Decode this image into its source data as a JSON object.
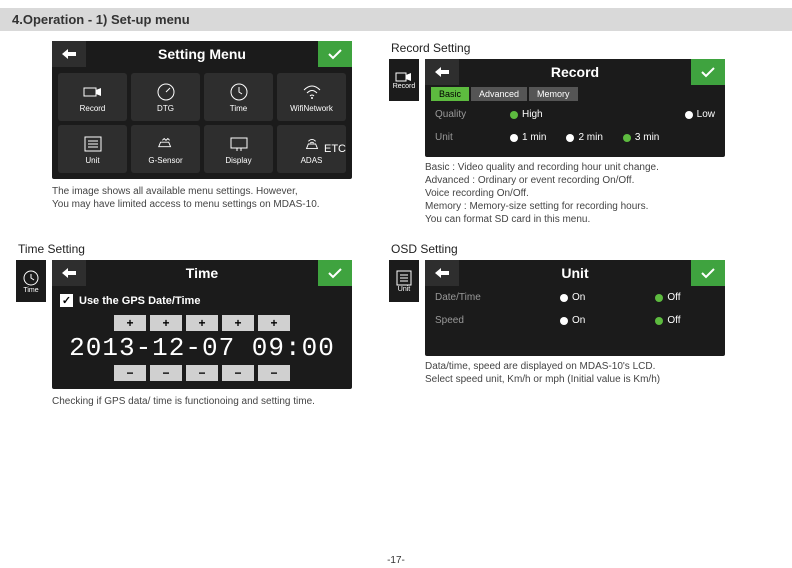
{
  "section_title": "4.Operation - 1) Set-up menu",
  "page_number": "-17-",
  "setting_menu": {
    "title": "Setting Menu",
    "items": [
      {
        "label": "Record"
      },
      {
        "label": "DTG"
      },
      {
        "label": "Time"
      },
      {
        "label": "WifiNetwork"
      },
      {
        "label": "Unit"
      },
      {
        "label": "G-Sensor"
      },
      {
        "label": "Display"
      },
      {
        "label": "ADAS"
      },
      {
        "label": "ETC"
      }
    ],
    "caption1": "The image shows all available menu settings. However,",
    "caption2": "You may have limited access to menu settings on MDAS-10."
  },
  "record": {
    "panel_title": "Record Setting",
    "title": "Record",
    "side_label": "Record",
    "tabs": [
      {
        "label": "Basic",
        "active": true
      },
      {
        "label": "Advanced"
      },
      {
        "label": "Memory"
      }
    ],
    "quality_label": "Quality",
    "quality_opts": [
      {
        "label": "High",
        "sel": true
      },
      {
        "label": "Low",
        "sel": false
      }
    ],
    "unit_label": "Unit",
    "unit_opts": [
      {
        "label": "1 min"
      },
      {
        "label": "2 min"
      },
      {
        "label": "3 min",
        "sel": true
      }
    ],
    "caption": "Basic : Video quality and recording hour unit change.\nAdvanced : Ordinary or event recording On/Off.\n                 Voice recording On/Off.\nMemory : Memory-size setting for recording hours.\n                You can format SD card in this menu."
  },
  "time": {
    "panel_title": "Time Setting",
    "title": "Time",
    "side_label": "Time",
    "use_gps": "Use the GPS Date/Time",
    "digits": "2013-12-07 09:00",
    "caption": "Checking if GPS data/ time is functionoing and setting time."
  },
  "osd": {
    "panel_title": "OSD Setting",
    "title": "Unit",
    "side_label": "Unit",
    "rows": [
      {
        "label": "Date/Time",
        "opts": [
          {
            "label": "On"
          },
          {
            "label": "Off",
            "sel": true
          }
        ]
      },
      {
        "label": "Speed",
        "opts": [
          {
            "label": "On"
          },
          {
            "label": "Off",
            "sel": true
          }
        ]
      }
    ],
    "caption": "Data/time, speed are displayed on  MDAS-10's LCD.\nSelect speed unit, Km/h  or mph (Initial value is Km/h)"
  }
}
